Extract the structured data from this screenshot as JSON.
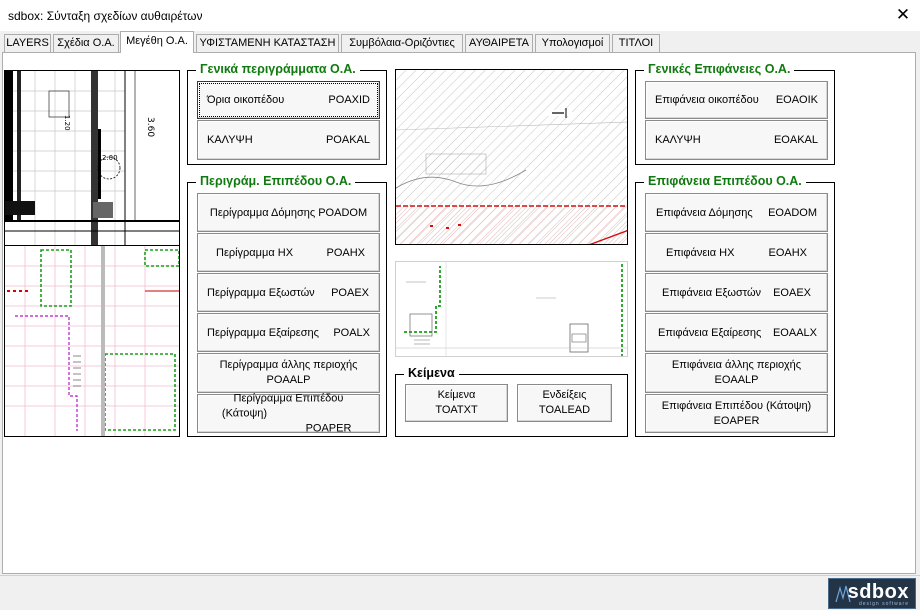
{
  "window": {
    "title": "sdbox: Σύνταξη σχεδίων αυθαιρέτων",
    "close_glyph": "✕"
  },
  "tabs": [
    {
      "label": "LAYERS",
      "active": false
    },
    {
      "label": "Σχέδια Ο.Α.",
      "active": false
    },
    {
      "label": "Μεγέθη Ο.Α.",
      "active": true
    },
    {
      "label": "ΥΦΙΣΤΑΜΕΝΗ ΚΑΤΑΣΤΑΣΗ",
      "active": false
    },
    {
      "label": "Συμβόλαια-Οριζόντιες",
      "active": false
    },
    {
      "label": "ΑΥΘΑΙΡΕΤΑ",
      "active": false
    },
    {
      "label": "Υπολογισμοί",
      "active": false
    },
    {
      "label": "ΤΙΤΛΟΙ",
      "active": false
    }
  ],
  "general_outlines": {
    "title": "Γενικά περιγράμματα Ο.Α.",
    "buttons": [
      {
        "label": "Όρια οικοπέδου",
        "code": "POAXID"
      },
      {
        "label": "ΚΑΛΥΨΗ",
        "code": "POAKAL"
      }
    ]
  },
  "level_outlines": {
    "title": "Περιγράμ. Επιπέδου Ο.Α.",
    "buttons": [
      {
        "label": "Περίγραμμα Δόμησης POADOM"
      },
      {
        "label": "Περίγραμμα ΗΧ",
        "code": "POAHX"
      },
      {
        "label": "Περίγραμμα Εξωστών",
        "code": "POAEX"
      },
      {
        "label": "Περίγραμμα Εξαίρεσης",
        "code": "POALX"
      },
      {
        "line1": "Περίγραμμα άλλης περιοχής",
        "line2": "POAALP"
      },
      {
        "line1": "Περίγραμμα Επιπέδου",
        "line2": "(Κάτοψη)",
        "code": "POAPER"
      }
    ]
  },
  "texts": {
    "title": "Κείμενα",
    "buttons": [
      {
        "line1": "Κείμενα",
        "line2": "TOATXT"
      },
      {
        "line1": "Ενδείξεις",
        "line2": "TOALEAD"
      }
    ]
  },
  "general_surfaces": {
    "title": "Γενικές Επιφάνειες Ο.Α.",
    "buttons": [
      {
        "label": "Επιφάνεια οικοπέδου",
        "code": "EOAOIK"
      },
      {
        "label": "ΚΑΛΥΨΗ",
        "code": "EOAKAL"
      }
    ]
  },
  "level_surfaces": {
    "title": "Επιφάνεια Επιπέδου Ο.Α.",
    "buttons": [
      {
        "label": "Επιφάνεια Δόμησης",
        "code": "EOADOM"
      },
      {
        "label": "Επιφάνεια ΗΧ",
        "code": "EOAHX"
      },
      {
        "label": "Επιφάνεια Εξωστών",
        "code": "EOAEX"
      },
      {
        "label": "Επιφάνεια Εξαίρεσης",
        "code": "EOAALX"
      },
      {
        "line1": "Επιφάνεια άλλης περιοχής",
        "line2": "EOAALP"
      },
      {
        "line1": "Επιφάνεια Επιπέδου (Κάτοψη)",
        "line2": "EOAPER"
      }
    ]
  },
  "drawing_labels": {
    "dim_vertical": "3.60",
    "dim_small": "1.20",
    "circle_label": "2.00"
  },
  "logo": {
    "text": "sdbox",
    "subtitle": "design software"
  },
  "colors": {
    "group_title_green": "#107a10",
    "logo_bg": "#233447"
  }
}
